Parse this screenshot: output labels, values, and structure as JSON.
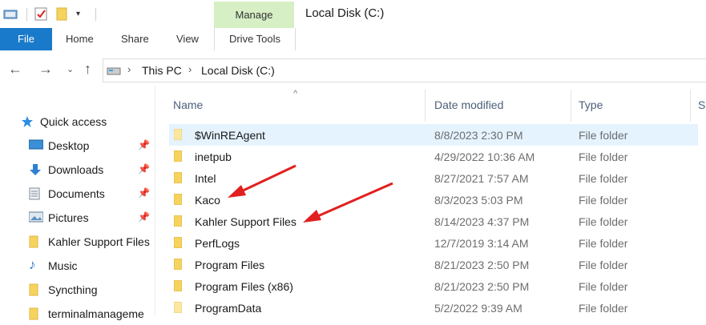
{
  "window": {
    "title": "Local Disk (C:)",
    "context_tab": "Manage",
    "context_subtab": "Drive Tools"
  },
  "ribbon": {
    "file": "File",
    "home": "Home",
    "share": "Share",
    "view": "View"
  },
  "address": {
    "crumbs": [
      "This PC",
      "Local Disk (C:)"
    ]
  },
  "navpane": {
    "quick_access": "Quick access",
    "items": [
      {
        "label": "Desktop",
        "icon": "desktop-icon",
        "pinned": true
      },
      {
        "label": "Downloads",
        "icon": "downloads-icon",
        "pinned": true
      },
      {
        "label": "Documents",
        "icon": "documents-icon",
        "pinned": true
      },
      {
        "label": "Pictures",
        "icon": "pictures-icon",
        "pinned": true
      },
      {
        "label": "Kahler Support Files",
        "icon": "folder-icon",
        "pinned": false
      },
      {
        "label": "Music",
        "icon": "music-icon",
        "pinned": false
      },
      {
        "label": "Syncthing",
        "icon": "folder-icon",
        "pinned": false
      },
      {
        "label": "terminalmanageme",
        "icon": "folder-icon",
        "pinned": false
      }
    ]
  },
  "columns": {
    "name": "Name",
    "date": "Date modified",
    "type": "Type",
    "size": "S"
  },
  "files": [
    {
      "name": "$WinREAgent",
      "date": "8/8/2023 2:30 PM",
      "type": "File folder"
    },
    {
      "name": "inetpub",
      "date": "4/29/2022 10:36 AM",
      "type": "File folder"
    },
    {
      "name": "Intel",
      "date": "8/27/2021 7:57 AM",
      "type": "File folder"
    },
    {
      "name": "Kaco",
      "date": "8/3/2023 5:03 PM",
      "type": "File folder"
    },
    {
      "name": "Kahler Support Files",
      "date": "8/14/2023 4:37 PM",
      "type": "File folder"
    },
    {
      "name": "PerfLogs",
      "date": "12/7/2019 3:14 AM",
      "type": "File folder"
    },
    {
      "name": "Program Files",
      "date": "8/21/2023 2:50 PM",
      "type": "File folder"
    },
    {
      "name": "Program Files (x86)",
      "date": "8/21/2023 2:50 PM",
      "type": "File folder"
    },
    {
      "name": "ProgramData",
      "date": "5/2/2022 9:39 AM",
      "type": "File folder"
    }
  ],
  "colors": {
    "file_tab": "#1979ca",
    "manage_tab": "#d6efc4",
    "selection": "#e5f3ff",
    "folder": "#f7d35e",
    "annotation_arrow": "#e21f1f"
  }
}
